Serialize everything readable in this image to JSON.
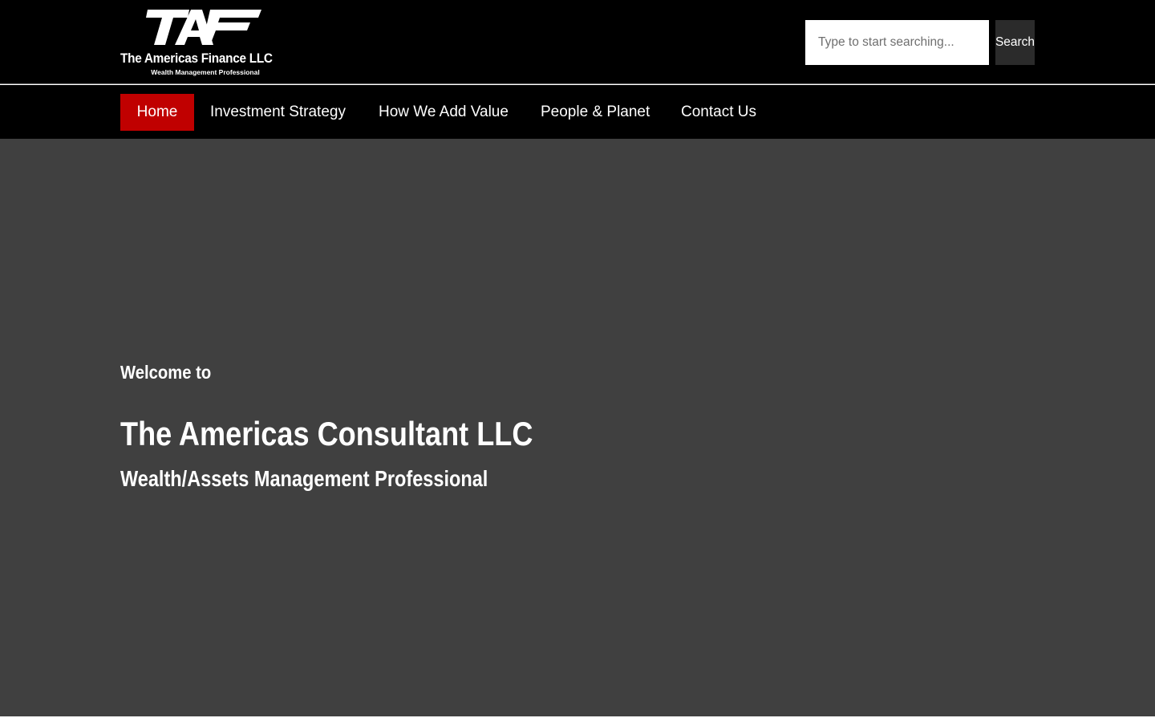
{
  "header": {
    "logo": {
      "mark": "TAF",
      "name": "The Americas Finance LLC",
      "tagline": "Wealth Management Professional"
    },
    "search": {
      "placeholder": "Type to start searching...",
      "value": "",
      "button_label": "Search"
    }
  },
  "nav": {
    "items": [
      {
        "label": "Home",
        "active": true
      },
      {
        "label": "Investment Strategy",
        "active": false
      },
      {
        "label": "How We Add Value",
        "active": false
      },
      {
        "label": "People & Planet",
        "active": false
      },
      {
        "label": "Contact Us",
        "active": false
      }
    ]
  },
  "hero": {
    "welcome": "Welcome to",
    "title": "The Americas Consultant LLC",
    "subtitle": "Wealth/Assets Management Professional"
  },
  "colors": {
    "header_bg": "#000000",
    "nav_active_bg": "#c00000",
    "hero_bg": "#404040",
    "search_button_bg": "#2b2b2b",
    "text": "#ffffff"
  }
}
